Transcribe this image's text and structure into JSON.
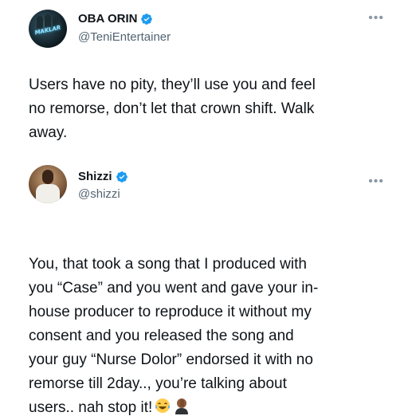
{
  "tweet1": {
    "name": "OBA ORIN",
    "handle": "@TeniEntertainer",
    "avatar_text": "MAKLAR",
    "text": "Users have no pity, they’ll use you and feel\nno remorse, don’t let that crown shift. Walk\naway.",
    "more_icon": "more-horizontal-icon"
  },
  "tweet2": {
    "name": "Shizzi",
    "handle": "@shizzi",
    "text": "You, that took a song that I produced with\nyou “Case” and you went and gave your in-\nhouse producer to reproduce it without my\nconsent and you released the song and\nyour guy “Nurse Dolor” endorsed it with no\nremorse till 2day.., you’re talking about\nusers.. nah stop it!",
    "more_icon": "more-horizontal-icon",
    "emojis": [
      "laughing-tears-icon",
      "facepalm-icon"
    ]
  },
  "colors": {
    "verified": "#1d9bf0",
    "text": "#0f1419",
    "secondary": "#536471"
  }
}
